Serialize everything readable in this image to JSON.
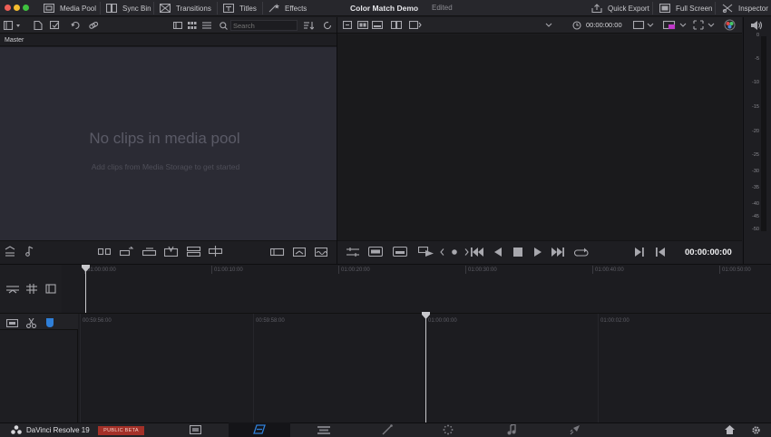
{
  "topbar": {
    "tabs_left": [
      {
        "label": "Media Pool",
        "icon": "media-pool-icon"
      },
      {
        "label": "Sync Bin",
        "icon": "sync-bin-icon"
      },
      {
        "label": "Transitions",
        "icon": "transitions-icon"
      },
      {
        "label": "Titles",
        "icon": "titles-icon"
      },
      {
        "label": "Effects",
        "icon": "effects-icon"
      }
    ],
    "project_title": "Color Match Demo",
    "project_status": "Edited",
    "tabs_right": [
      {
        "label": "Quick Export",
        "icon": "quick-export-icon"
      },
      {
        "label": "Full Screen",
        "icon": "full-screen-icon"
      },
      {
        "label": "Inspector",
        "icon": "inspector-icon"
      }
    ]
  },
  "media_pool": {
    "search_placeholder": "Search",
    "bin_label": "Master",
    "empty_title": "No clips in media pool",
    "empty_subtitle": "Add clips from Media Storage to get started"
  },
  "viewer": {
    "timecode": "00:00:00:00",
    "transport_timecode": "00:00:00:00"
  },
  "audio_meter": {
    "ticks": [
      "0",
      "-5",
      "-10",
      "-15",
      "-20",
      "-25",
      "-30",
      "-35",
      "-40",
      "-45",
      "-50"
    ]
  },
  "timeline": {
    "upper_ruler": [
      "01:00:00:00",
      "01:00:10:00",
      "01:00:20:00",
      "01:00:30:00",
      "01:00:40:00",
      "01:00:50:00"
    ],
    "lower_ruler": [
      "00:59:56:00",
      "00:59:58:00",
      "01:00:00:00",
      "01:00:02:00"
    ]
  },
  "pagebar": {
    "brand": "DaVinci Resolve 19",
    "badge": "PUBLIC BETA",
    "active_page": "cut-page"
  },
  "colors": {
    "accent_blue": "#2f7fd8",
    "badge_red": "#a33028"
  }
}
